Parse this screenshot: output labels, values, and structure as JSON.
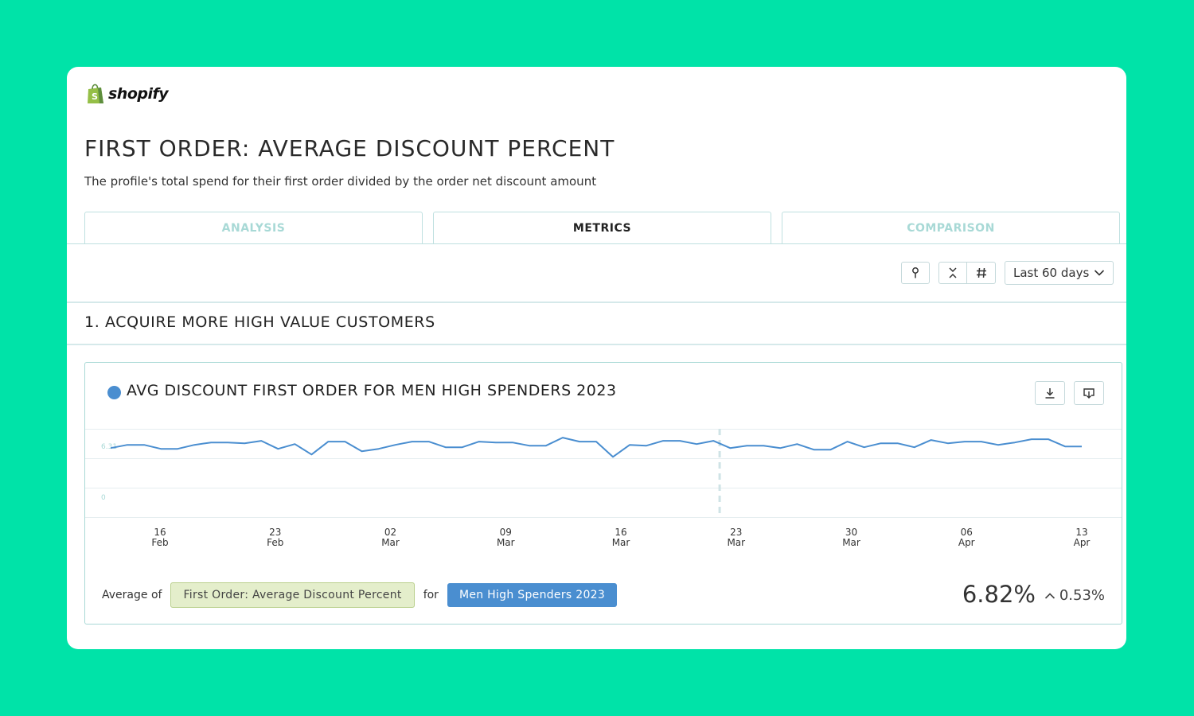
{
  "brand": {
    "name": "shopify",
    "logo_color": "#95bf47"
  },
  "page": {
    "title": "FIRST ORDER: AVERAGE DISCOUNT PERCENT",
    "description": "The profile's total spend for their first order divided by the order net discount amount"
  },
  "tabs": [
    {
      "label": "ANALYSIS",
      "active": false
    },
    {
      "label": "METRICS",
      "active": true
    },
    {
      "label": "COMPARISON",
      "active": false
    }
  ],
  "toolbar": {
    "icons": [
      "pin-icon",
      "collapse-icon",
      "hash-icon"
    ],
    "range_label": "Last 60 days"
  },
  "section": {
    "title": "1. ACQUIRE MORE HIGH VALUE CUSTOMERS"
  },
  "metric": {
    "title": "AVG DISCOUNT FIRST ORDER FOR MEN HIGH SPENDERS 2023",
    "series_color": "#4a8ed0",
    "footer_prefix": "Average of",
    "metric_chip": "First Order: Average Discount Percent",
    "for_label": "for",
    "segment_chip": "Men High Spenders 2023",
    "value": "6.82%",
    "delta": "0.53%",
    "delta_direction": "up",
    "actions": [
      "download-icon",
      "export-icon"
    ]
  },
  "chart_data": {
    "type": "line",
    "y_tick_labels": [
      "6.31",
      "0"
    ],
    "ylim": [
      -2.5,
      8.5
    ],
    "x_tick_labels": [
      [
        "16",
        "Feb"
      ],
      [
        "23",
        "Feb"
      ],
      [
        "02",
        "Mar"
      ],
      [
        "09",
        "Mar"
      ],
      [
        "16",
        "Mar"
      ],
      [
        "23",
        "Mar"
      ],
      [
        "30",
        "Mar"
      ],
      [
        "06",
        "Apr"
      ],
      [
        "13",
        "Apr"
      ]
    ],
    "x_start_label": "13 Feb",
    "x_end_label": "13 Apr",
    "marker_date": "22 Mar",
    "grid": true,
    "series": [
      {
        "values": [
          6.1,
          6.5,
          6.5,
          6.0,
          6.0,
          6.5,
          6.8,
          6.8,
          6.7,
          7.0,
          6.0,
          6.6,
          5.3,
          6.9,
          6.9,
          5.7,
          6.0,
          6.5,
          6.9,
          6.9,
          6.2,
          6.2,
          6.9,
          6.8,
          6.8,
          6.4,
          6.4,
          7.4,
          6.9,
          6.9,
          5.0,
          6.5,
          6.4,
          7.0,
          7.0,
          6.6,
          7.0,
          6.1,
          6.4,
          6.4,
          6.1,
          6.6,
          5.9,
          5.9,
          6.9,
          6.2,
          6.7,
          6.7,
          6.2,
          7.1,
          6.7,
          6.9,
          6.9,
          6.5,
          6.8,
          7.2,
          7.2,
          6.3,
          6.3
        ]
      }
    ]
  }
}
